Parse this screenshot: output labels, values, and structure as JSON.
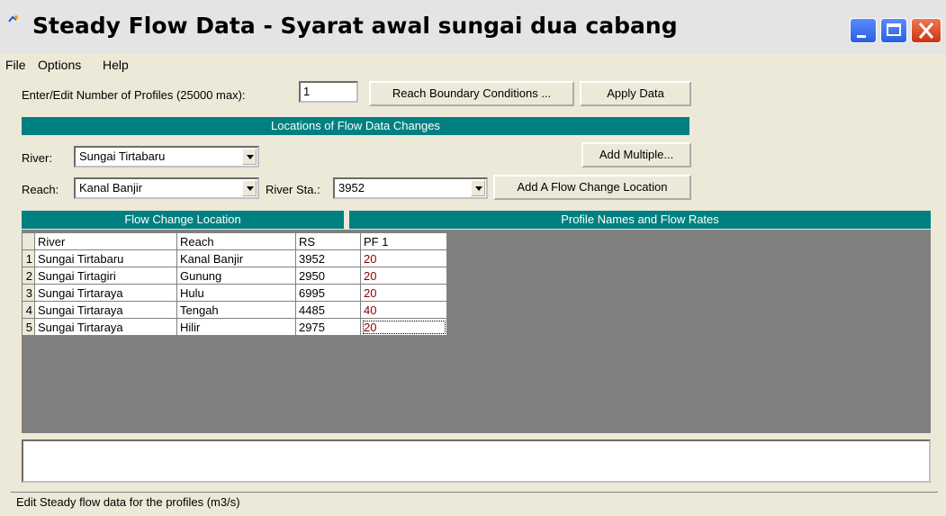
{
  "window": {
    "title": "Steady Flow Data - Syarat awal sungai dua cabang",
    "colors": {
      "teal": "#008080",
      "flow_value": "#8b0000"
    }
  },
  "menu": [
    "File",
    "Options",
    "Help"
  ],
  "profiles": {
    "label": "Enter/Edit Number of Profiles (25000 max):",
    "value": "1",
    "reach_boundary_button": "Reach Boundary Conditions ...",
    "apply_button": "Apply Data"
  },
  "locations_header": "Locations of Flow Data Changes",
  "river": {
    "label": "River:",
    "value": "Sungai Tirtabaru"
  },
  "add_multiple_button": "Add Multiple...",
  "reach": {
    "label": "Reach:",
    "value": "Kanal Banjir"
  },
  "river_sta": {
    "label": "River Sta.:",
    "value": "3952"
  },
  "add_location_button": "Add A Flow Change Location",
  "table": {
    "left_header": "Flow Change Location",
    "right_header": "Profile Names and Flow Rates",
    "columns": [
      "River",
      "Reach",
      "RS",
      "PF 1"
    ],
    "rows": [
      {
        "num": "1",
        "river": "Sungai Tirtabaru",
        "reach": "Kanal Banjir",
        "rs": "3952",
        "pf1": "20"
      },
      {
        "num": "2",
        "river": "Sungai Tirtagiri",
        "reach": "Gunung",
        "rs": "2950",
        "pf1": "20"
      },
      {
        "num": "3",
        "river": "Sungai Tirtaraya",
        "reach": "Hulu",
        "rs": "6995",
        "pf1": "20"
      },
      {
        "num": "4",
        "river": "Sungai Tirtaraya",
        "reach": "Tengah",
        "rs": "4485",
        "pf1": "40"
      },
      {
        "num": "5",
        "river": "Sungai Tirtaraya",
        "reach": "Hilir",
        "rs": "2975",
        "pf1": "20"
      }
    ]
  },
  "status": "Edit Steady flow data for the profiles (m3/s)"
}
